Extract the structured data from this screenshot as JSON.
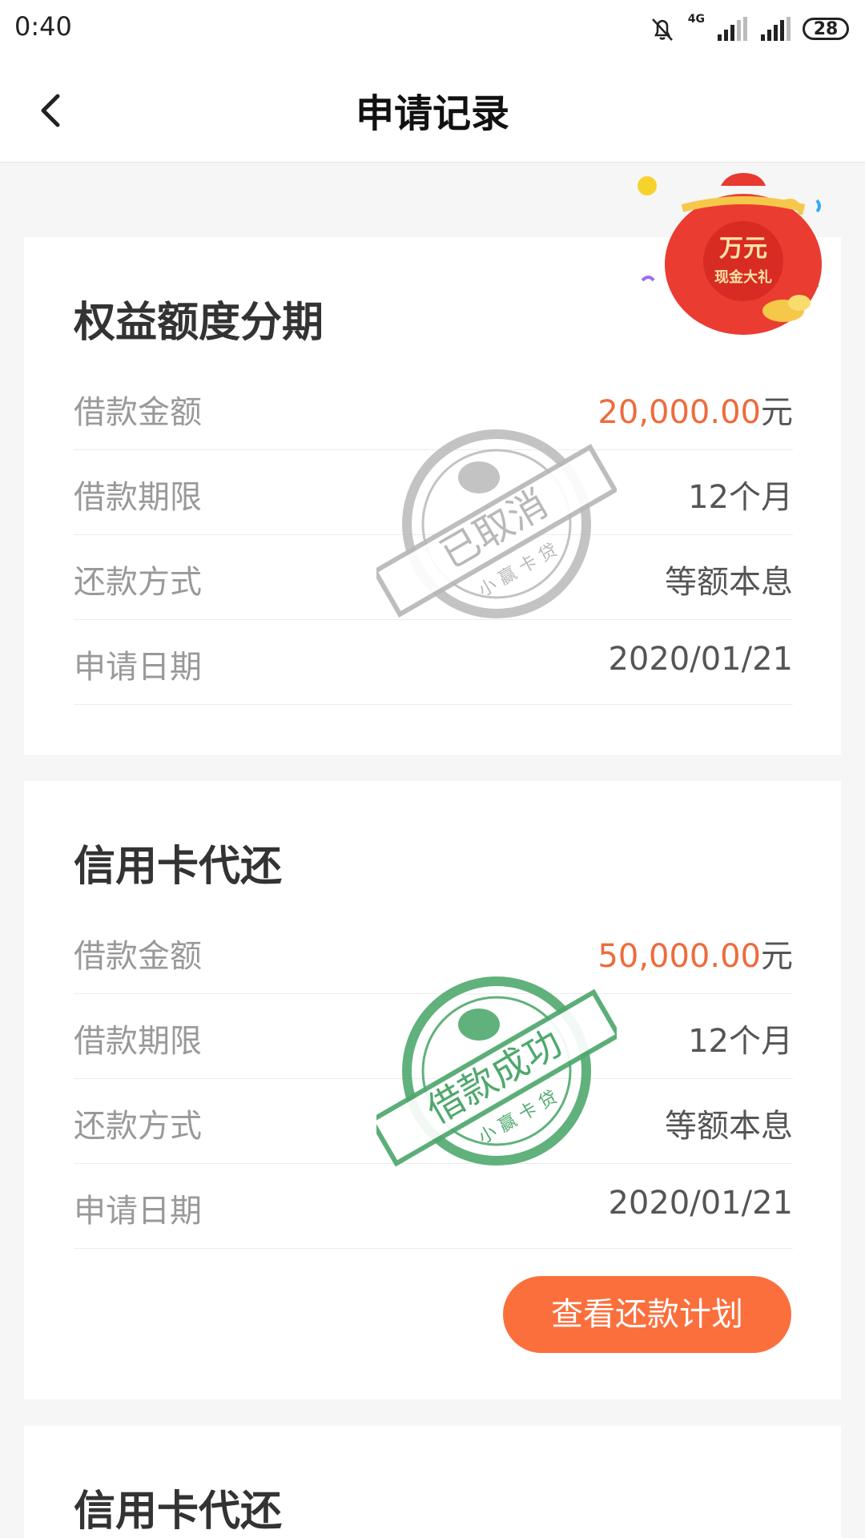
{
  "status_bar": {
    "time": "0:40",
    "network": "4G",
    "battery": "28",
    "icons": [
      "bell-muted-icon",
      "signal-icon",
      "signal-icon",
      "battery-icon"
    ]
  },
  "header": {
    "title": "申请记录",
    "back_icon": "chevron-left-icon"
  },
  "promo": {
    "line1": "万元",
    "line2": "现金大礼"
  },
  "cards": [
    {
      "title": "权益额度分期",
      "rows": [
        {
          "label": "借款金额",
          "value": "20,000.00",
          "unit": "元"
        },
        {
          "label": "借款期限",
          "value": "12个月"
        },
        {
          "label": "还款方式",
          "value": "等额本息"
        },
        {
          "label": "申请日期",
          "value": "2020/01/21"
        }
      ],
      "stamp": {
        "status": "已取消",
        "brand": "小 赢 卡 贷",
        "color": "#b8b8b8"
      }
    },
    {
      "title": "信用卡代还",
      "rows": [
        {
          "label": "借款金额",
          "value": "50,000.00",
          "unit": "元"
        },
        {
          "label": "借款期限",
          "value": "12个月"
        },
        {
          "label": "还款方式",
          "value": "等额本息"
        },
        {
          "label": "申请日期",
          "value": "2020/01/21"
        }
      ],
      "stamp": {
        "status": "借款成功",
        "brand": "小 赢 卡 贷",
        "color": "#4fa86d"
      },
      "button": "查看还款计划"
    },
    {
      "title": "信用卡代还"
    }
  ],
  "colors": {
    "accent": "#fb6f3d",
    "amount": "#ee6b3c",
    "cancel_stamp": "#b8b8b8",
    "success_stamp": "#4fa86d"
  }
}
